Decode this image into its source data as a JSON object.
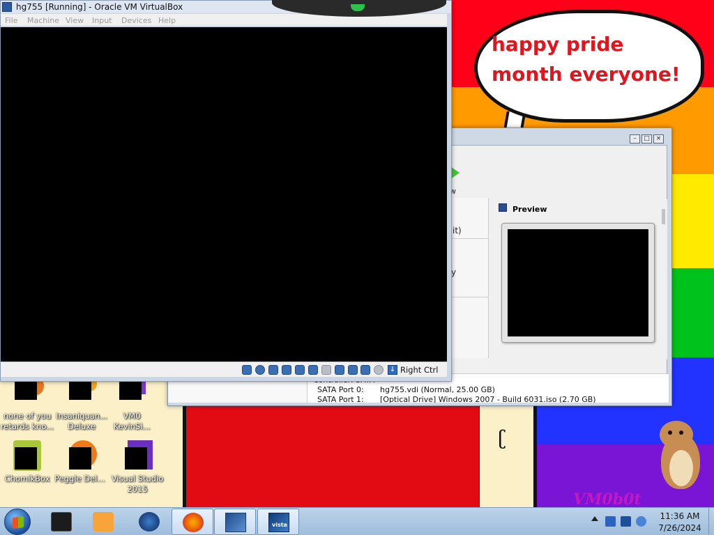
{
  "vm_window": {
    "title": "hg755 [Running] - Oracle VM VirtualBox",
    "menu": [
      "File",
      "Machine",
      "View",
      "Input",
      "Devices",
      "Help"
    ],
    "host_key_label": "Right Ctrl"
  },
  "manager_window": {
    "toolbar_label_fragment": "w",
    "details_fragments": [
      "it)",
      "y"
    ],
    "preview_title": "Preview",
    "storage_lines": [
      {
        "label": "Controller: SATA",
        "value": ""
      },
      {
        "label": "SATA Port 0:",
        "value": "hg755.vdi (Normal, 25.00 GB)"
      },
      {
        "label": "SATA Port 1:",
        "value": "[Optical Drive] Windows 2007 - Build 6031.iso (2.70 GB)"
      }
    ]
  },
  "wallpaper": {
    "bubble_text": "happy pride month everyone!",
    "signature": "VM0b0t"
  },
  "desktop_icons": [
    {
      "label": "none of you retards kno..."
    },
    {
      "label": "Insaniquan... Deluxe"
    },
    {
      "label": "VM0 KevinSi..."
    },
    {
      "label": "ChomikBox"
    },
    {
      "label": "Peggle Deluxe"
    },
    {
      "label": "Visual Studio 2015"
    }
  ],
  "taskbar": {
    "pinned": [
      {
        "icon": "cmd-icon"
      },
      {
        "icon": "media-player-icon"
      },
      {
        "icon": "globe-icon"
      },
      {
        "icon": "firefox-icon"
      },
      {
        "icon": "virtualbox-icon"
      },
      {
        "icon": "vista-icon"
      }
    ],
    "vista_label": "vista",
    "clock_time": "11:36 AM",
    "clock_date": "7/26/2024"
  },
  "colors": {
    "pride_red": "#ff0018",
    "pride_orange": "#ff9a00",
    "pride_yellow": "#ffea00",
    "pride_green": "#00c21c",
    "pride_blue": "#2233ff",
    "pride_purple": "#7a15d6",
    "bubble_text": "#e0151d"
  }
}
